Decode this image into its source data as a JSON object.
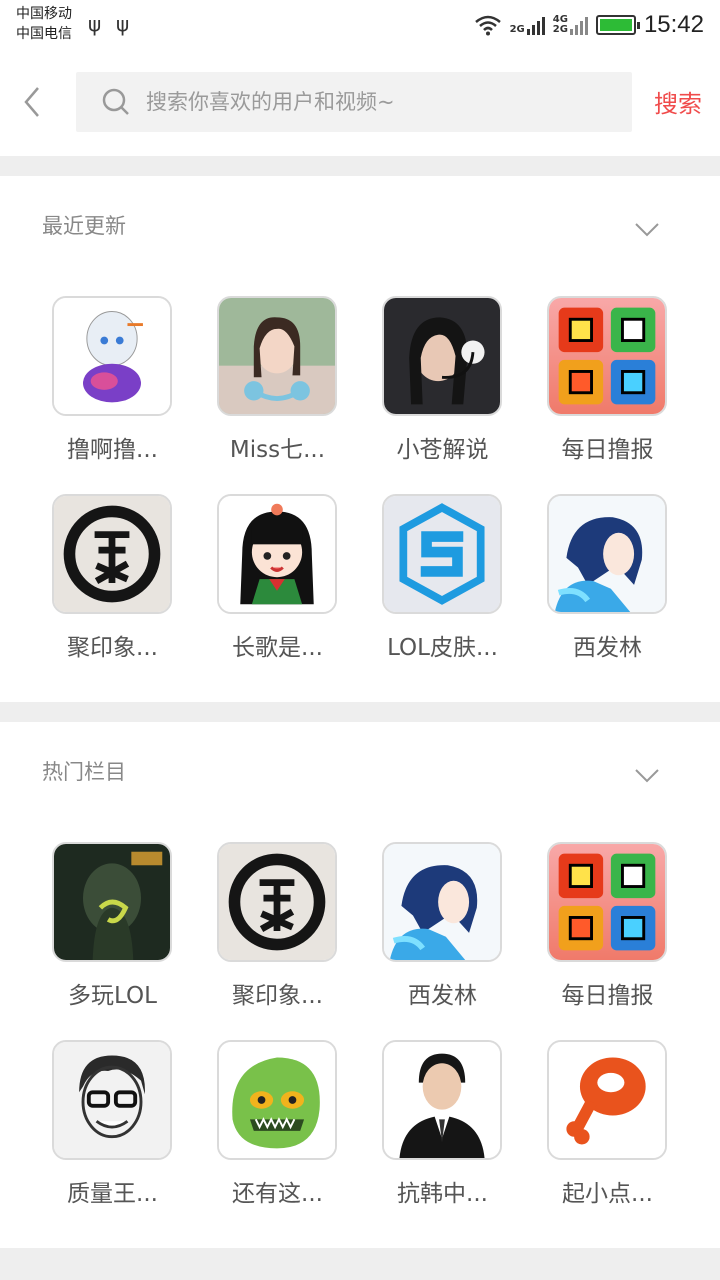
{
  "status": {
    "carrier1": "中国移动",
    "carrier2": "中国电信",
    "net1": "2G",
    "net2": "4G",
    "net3": "2G",
    "time": "15:42"
  },
  "search": {
    "placeholder": "搜索你喜欢的用户和视频~",
    "button_label": "搜索"
  },
  "recent": {
    "title": "最近更新",
    "items": [
      {
        "label": "撸啊撸...",
        "icon": "anime-girl-avatar"
      },
      {
        "label": "Miss七...",
        "icon": "girl-headphones-avatar"
      },
      {
        "label": "小苍解说",
        "icon": "headset-caster-avatar"
      },
      {
        "label": "每日撸报",
        "icon": "daily-news-logo"
      },
      {
        "label": "聚印象...",
        "icon": "ink-circle-logo"
      },
      {
        "label": "长歌是...",
        "icon": "chibi-girl-avatar"
      },
      {
        "label": "LOL皮肤...",
        "icon": "blue-s-logo"
      },
      {
        "label": "西发林",
        "icon": "blue-hair-anime-avatar"
      }
    ]
  },
  "hot": {
    "title": "热门栏目",
    "items": [
      {
        "label": "多玩LOL",
        "icon": "lol-champion-avatar"
      },
      {
        "label": "聚印象...",
        "icon": "ink-circle-logo"
      },
      {
        "label": "西发林",
        "icon": "blue-hair-anime-avatar"
      },
      {
        "label": "每日撸报",
        "icon": "daily-news-logo"
      },
      {
        "label": "质量王...",
        "icon": "sketch-glasses-avatar"
      },
      {
        "label": "还有这...",
        "icon": "green-monster-avatar"
      },
      {
        "label": "抗韩中...",
        "icon": "suit-man-avatar"
      },
      {
        "label": "起小点...",
        "icon": "meat-drumstick-logo"
      }
    ]
  },
  "colors": {
    "accent": "#f04b4b",
    "divider": "#eeeeee",
    "search_bg": "#f2f2f2"
  }
}
